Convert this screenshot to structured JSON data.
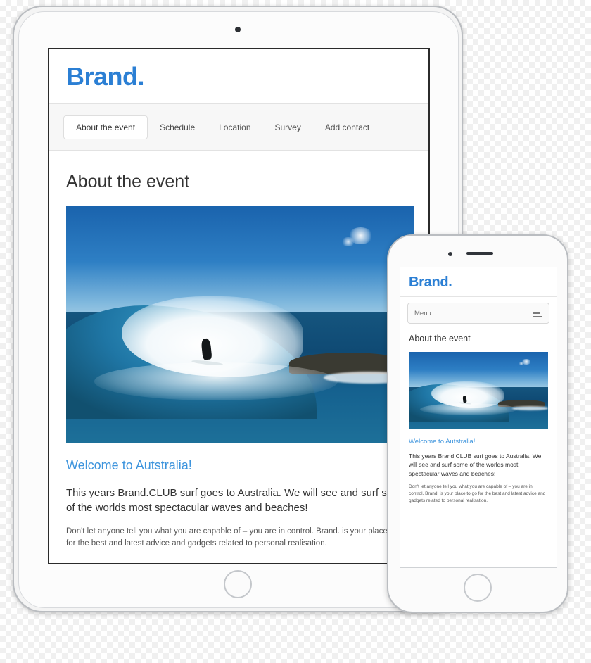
{
  "brand": {
    "name": "Brand",
    "dot": "."
  },
  "tablet": {
    "nav": [
      {
        "label": "About the event",
        "active": true
      },
      {
        "label": "Schedule",
        "active": false
      },
      {
        "label": "Location",
        "active": false
      },
      {
        "label": "Survey",
        "active": false
      },
      {
        "label": "Add contact",
        "active": false
      }
    ],
    "page_title": "About the event",
    "hero_alt": "surfer-riding-barrel-wave",
    "welcome_heading": "Welcome to Autstralia!",
    "lede": "This years Brand.CLUB surf goes to Australia. We will see and surf some of the worlds most spectacular waves and beaches!",
    "paragraph": "Don't let anyone tell you what you are capable of – you are in control. Brand. is your place to go for the best and latest advice and gadgets related to personal realisation."
  },
  "phone": {
    "menu_label": "Menu",
    "menu_icon": "hamburger-icon",
    "page_title": "About the event",
    "hero_alt": "surfer-riding-barrel-wave",
    "welcome_heading": "Welcome to Autstralia!",
    "lede": "This years Brand.CLUB surf goes to Australia. We will see and surf some of the worlds most spectacular waves and beaches!",
    "paragraph": "Don't let anyone tell you what you are capable of – you are in control. Brand. is your place to go for the best and latest advice and gadgets related to personal realisation."
  },
  "colors": {
    "brand_blue": "#2b7fd4",
    "link_blue": "#3d94dd",
    "nav_bg": "#f7f7f7",
    "text": "#333333"
  }
}
